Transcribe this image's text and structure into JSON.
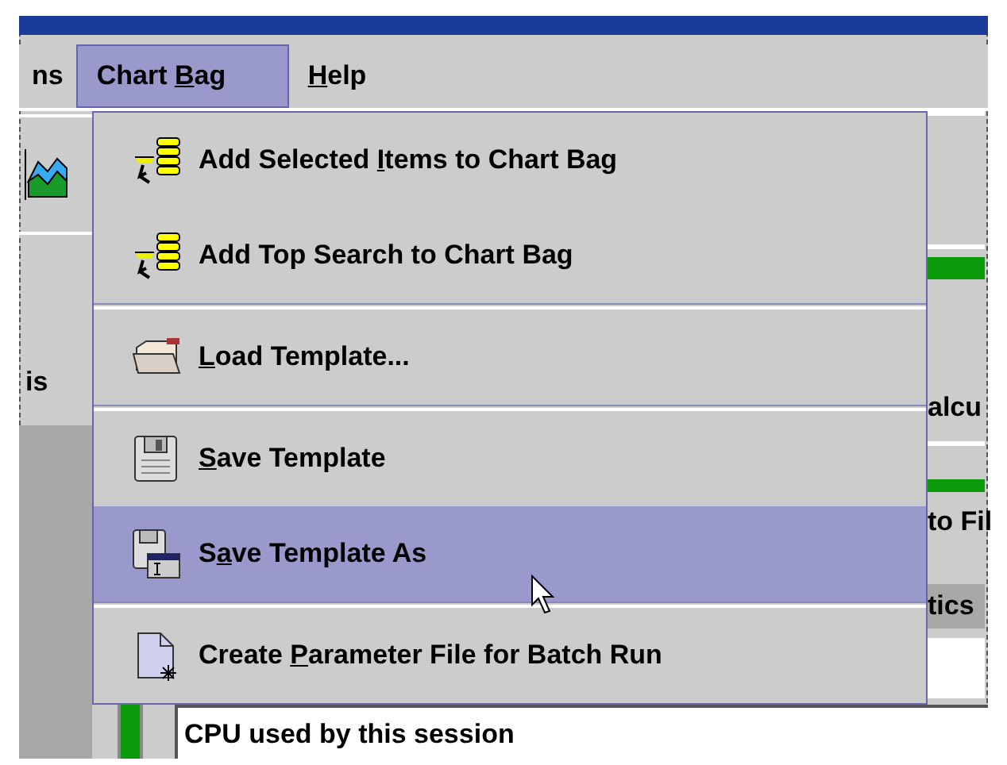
{
  "menu_bar": [
    {
      "label": {
        "before": "ns"
      },
      "selected": false
    },
    {
      "label": {
        "before": "Chart ",
        "key": "B",
        "after": "ag"
      },
      "selected": true
    },
    {
      "label": {
        "key": "H",
        "after": "elp"
      },
      "selected": false
    }
  ],
  "menu": {
    "items": [
      {
        "kind": "stack-add",
        "label": {
          "before": "Add Selected ",
          "key": "I",
          "after": "tems to Chart Bag"
        },
        "separator_before": false,
        "selected": false
      },
      {
        "kind": "stack-add",
        "label": {
          "before": "Add Top Search to Chart Bag"
        },
        "separator_before": false,
        "selected": false
      },
      {
        "kind": "folder",
        "label": {
          "key": "L",
          "after": "oad Template..."
        },
        "separator_before": true,
        "selected": false
      },
      {
        "kind": "floppy",
        "label": {
          "key": "S",
          "after": "ave Template"
        },
        "separator_before": true,
        "selected": false
      },
      {
        "kind": "floppy-window",
        "label": {
          "before": "S",
          "key": "a",
          "after": "ve Template As"
        },
        "separator_before": false,
        "selected": true
      },
      {
        "kind": "document",
        "label": {
          "before": "Create ",
          "key": "P",
          "after": "arameter File for Batch Run"
        },
        "separator_before": true,
        "selected": false
      }
    ]
  },
  "background_texts": [
    {
      "text": "is"
    },
    {
      "text": "alcu"
    },
    {
      "text": "to Fil"
    },
    {
      "text": "tics"
    }
  ],
  "status_field": {
    "text": "CPU used by this session"
  }
}
